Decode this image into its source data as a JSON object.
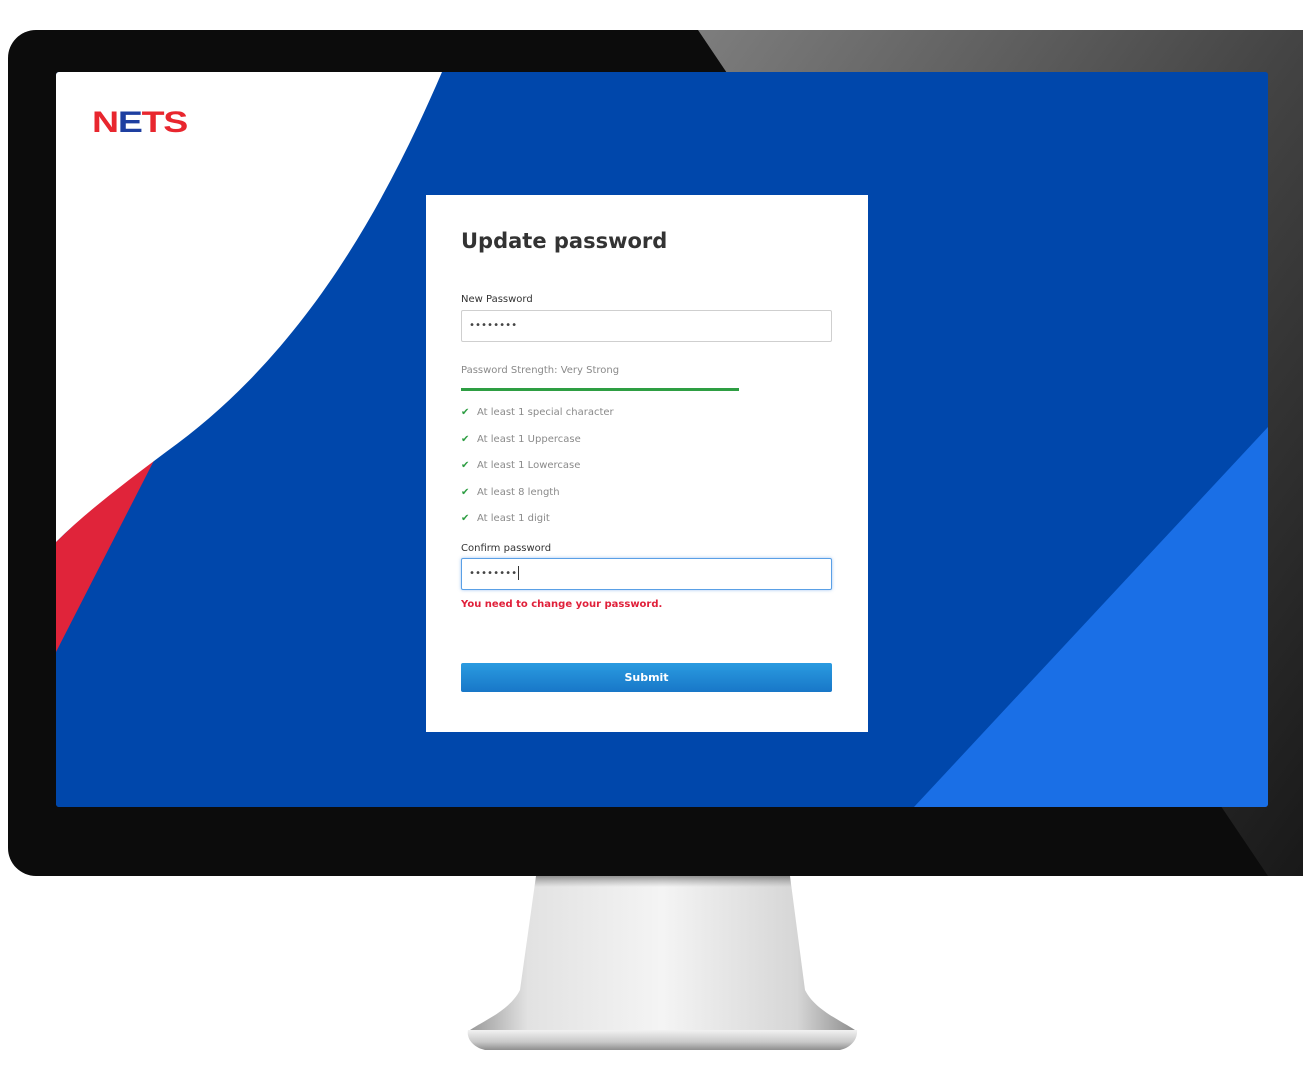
{
  "brand": {
    "logo_part1": "N",
    "logo_part2": "E",
    "logo_part3": "TS"
  },
  "form": {
    "title": "Update password",
    "new_password_label": "New Password",
    "new_password_value": "••••••••",
    "strength_text": "Password Strength: Very Strong",
    "strength_level": 1.0,
    "rules": [
      {
        "icon": "check-icon",
        "text": "At least 1 special character"
      },
      {
        "icon": "check-icon",
        "text": "At least 1 Uppercase"
      },
      {
        "icon": "check-icon",
        "text": "At least 1 Lowercase"
      },
      {
        "icon": "check-icon",
        "text": "At least 8 length"
      },
      {
        "icon": "check-icon",
        "text": "At least 1 digit"
      }
    ],
    "confirm_label": "Confirm password",
    "confirm_value": "••••••••",
    "error_text": "You need to change your password.",
    "submit_label": "Submit"
  },
  "colors": {
    "screen_blue": "#0047ab",
    "accent_light_blue": "#1a6fe6",
    "brand_red": "#e8262e",
    "success_green": "#2e9e43",
    "error_red": "#e0203a",
    "button_blue": "#1f88d4"
  }
}
